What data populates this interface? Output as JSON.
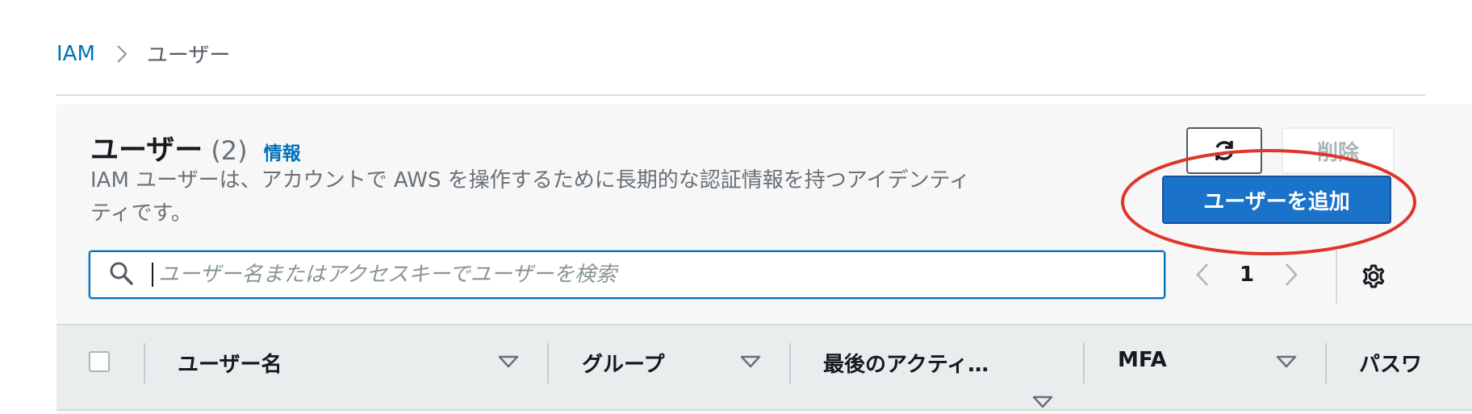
{
  "breadcrumb": {
    "root": "IAM",
    "current": "ユーザー"
  },
  "header": {
    "title": "ユーザー",
    "count": "(2)",
    "info_link": "情報",
    "description": "IAM ユーザーは、アカウントで AWS を操作するために長期的な認証情報を持つアイデンティティです。"
  },
  "actions": {
    "refresh_icon": "refresh-icon",
    "delete_label": "削除",
    "add_user_label": "ユーザーを追加"
  },
  "search": {
    "placeholder": "ユーザー名またはアクセスキーでユーザーを検索",
    "value": ""
  },
  "pagination": {
    "current_page": "1"
  },
  "table": {
    "columns": [
      {
        "label": "ユーザー名"
      },
      {
        "label": "グループ"
      },
      {
        "label": "最後のアクティ…"
      },
      {
        "label": "MFA"
      },
      {
        "label": "パスワ"
      }
    ]
  },
  "colors": {
    "primary": "#1a72c9",
    "link": "#0073bb",
    "annotation": "#e0352b"
  }
}
